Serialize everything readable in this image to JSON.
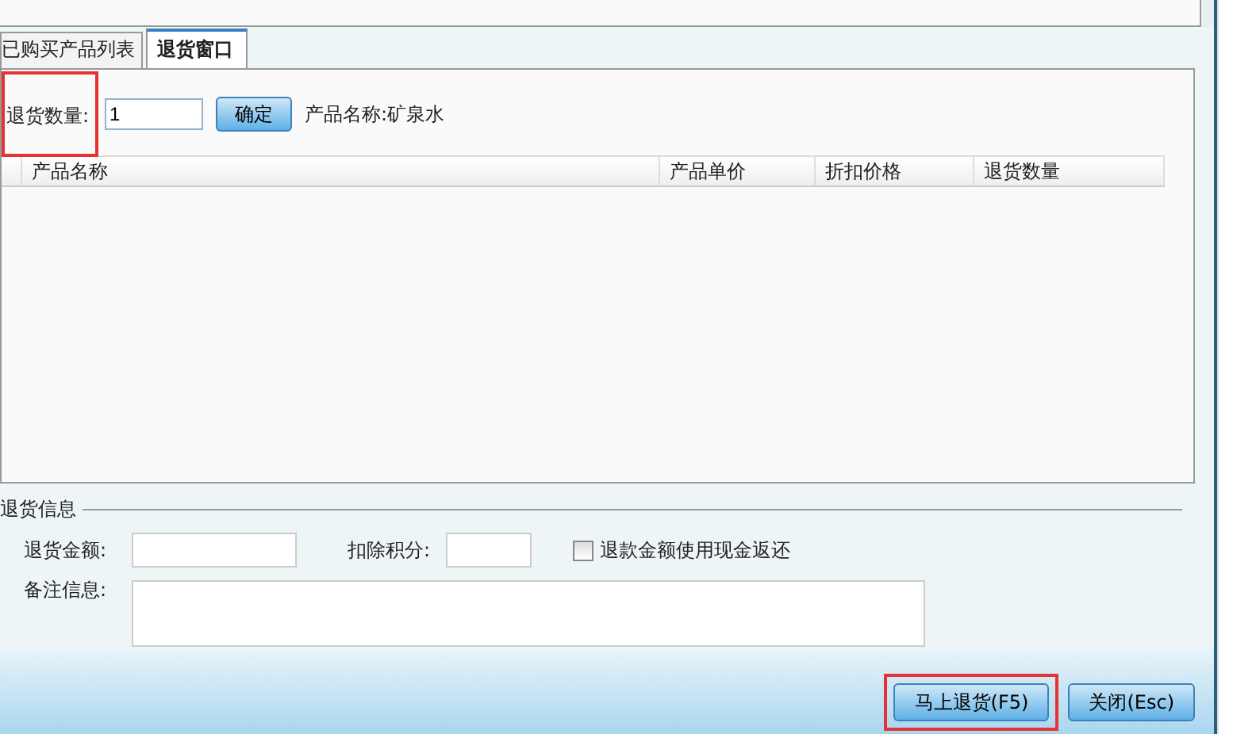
{
  "tabs": [
    {
      "label": "已购买产品列表",
      "selected": false
    },
    {
      "label": "退货窗口",
      "selected": true
    }
  ],
  "return_qty": {
    "label": "退货数量:",
    "value": "1",
    "highlighted": true
  },
  "confirm_button": "确定",
  "product_name": "产品名称:矿泉水",
  "table": {
    "columns": [
      "产品名称",
      "产品单价",
      "折扣价格",
      "退货数量"
    ]
  },
  "return_info": {
    "title": "退货信息",
    "amount_label": "退货金额:",
    "points_label": "扣除积分:",
    "cash_refund": {
      "label": "退款金额使用现金返还",
      "checked": false
    },
    "remarks_label": "备注信息:"
  },
  "buttons": [
    {
      "label": "马上退货(F5)",
      "highlighted": true
    },
    {
      "label": "关闭(Esc)",
      "highlighted": false
    }
  ]
}
